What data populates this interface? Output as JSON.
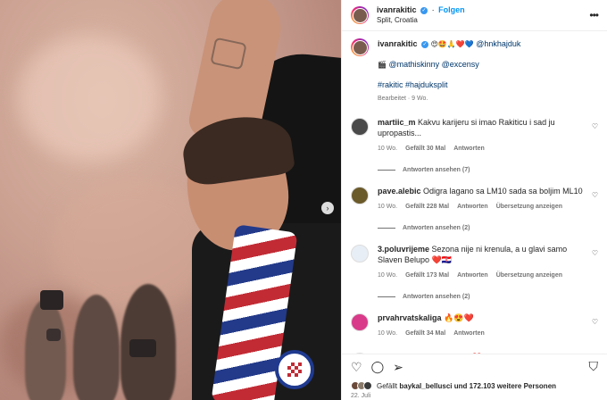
{
  "post": {
    "username": "ivanrakitic",
    "follow_label": "Folgen",
    "location": "Split, Croatia",
    "more_icon": "more-horizontal-icon",
    "next_icon": "chevron-right-icon"
  },
  "caption": {
    "username": "ivanrakitic",
    "emojis": "😍🤩🙏❤️💙",
    "mention_club": "@hnkhajduk",
    "clapper": "🎬",
    "mentions": "@mathiskinny @excensy",
    "hashtags": "#rakitic #hajduksplit",
    "edited": "Bearbeitet · 9 Wo."
  },
  "comments": [
    {
      "user": "martiic_m",
      "text": "Kakvu karijeru si imao Rakiticu i sad ju upropastis...",
      "age": "10 Wo.",
      "likes": "Gefällt 30 Mal",
      "reply": "Antworten",
      "translate": "",
      "replies_link": "Antworten ansehen (7)",
      "avatar_color": "#4a4a4a"
    },
    {
      "user": "pave.alebic",
      "text": "Odigra lagano sa LM10 sada sa boljim ML10",
      "age": "10 Wo.",
      "likes": "Gefällt 228 Mal",
      "reply": "Antworten",
      "translate": "Übersetzung anzeigen",
      "replies_link": "Antworten ansehen (2)",
      "avatar_color": "#6b5a2a"
    },
    {
      "user": "3.poluvrijeme",
      "text": "Sezona nije ni krenula, a u glavi samo Slaven Belupo ❤️🇭🇷",
      "age": "10 Wo.",
      "likes": "Gefällt 173 Mal",
      "reply": "Antworten",
      "translate": "Übersetzung anzeigen",
      "replies_link": "Antworten ansehen (2)",
      "avatar_color": "#e8eef5"
    },
    {
      "user": "prvahrvatskaliga",
      "text": "🔥😍❤️",
      "age": "10 Wo.",
      "likes": "Gefällt 34 Mal",
      "reply": "Antworten",
      "translate": "",
      "replies_link": "",
      "avatar_color": "#d93a8a"
    },
    {
      "user": "nogometnevijesti",
      "text": "Sretno ❤️",
      "age": "",
      "likes": "",
      "reply": "",
      "translate": "",
      "replies_link": "",
      "avatar_color": "#1b1b1b"
    }
  ],
  "actions": {
    "like_icon": "heart-icon",
    "comment_icon": "comment-icon",
    "share_icon": "send-icon",
    "save_icon": "bookmark-icon",
    "likes_prefix": "Gefällt",
    "likes_user": "baykal_bellusci",
    "likes_suffix": "und 172.103 weitere Personen",
    "date": "22. Juli"
  },
  "colors": {
    "accent": "#0095f6",
    "link": "#00376b",
    "heart_red": "#ed4956",
    "hajduk_blue": "#233a8a",
    "hajduk_red": "#c22b34"
  }
}
